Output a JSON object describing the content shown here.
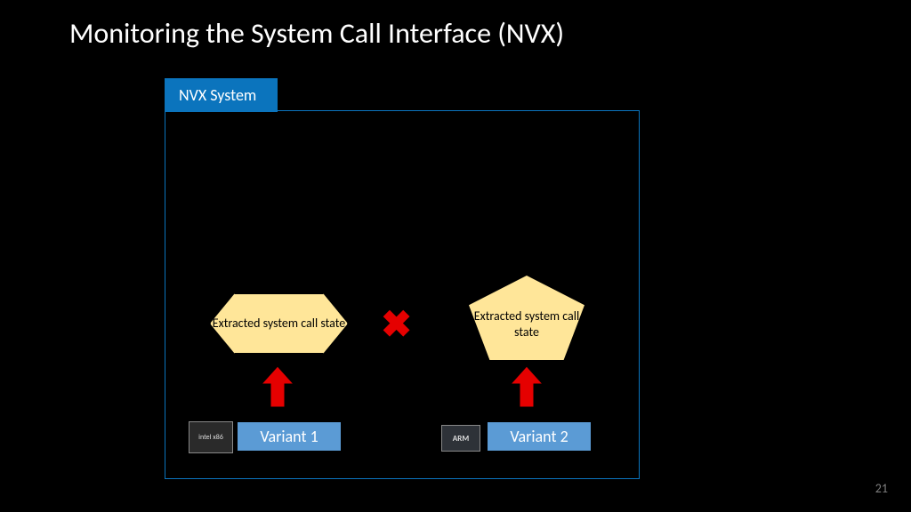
{
  "title": "Monitoring the System Call Interface (NVX)",
  "nvx_tab": "NVX System",
  "hexagon_text": "Extracted system call state",
  "pentagon_text": "Extracted system call state",
  "cross_glyph": "✖",
  "variant1": "Variant 1",
  "variant2": "Variant 2",
  "chip_intel": "intel\nx86",
  "chip_arm": "ARM",
  "page_number": "21",
  "colors": {
    "blue_tab": "#0b74bd",
    "blue_variant": "#5b9bd5",
    "yellow_shape": "#ffe699",
    "red": "#e50000"
  }
}
